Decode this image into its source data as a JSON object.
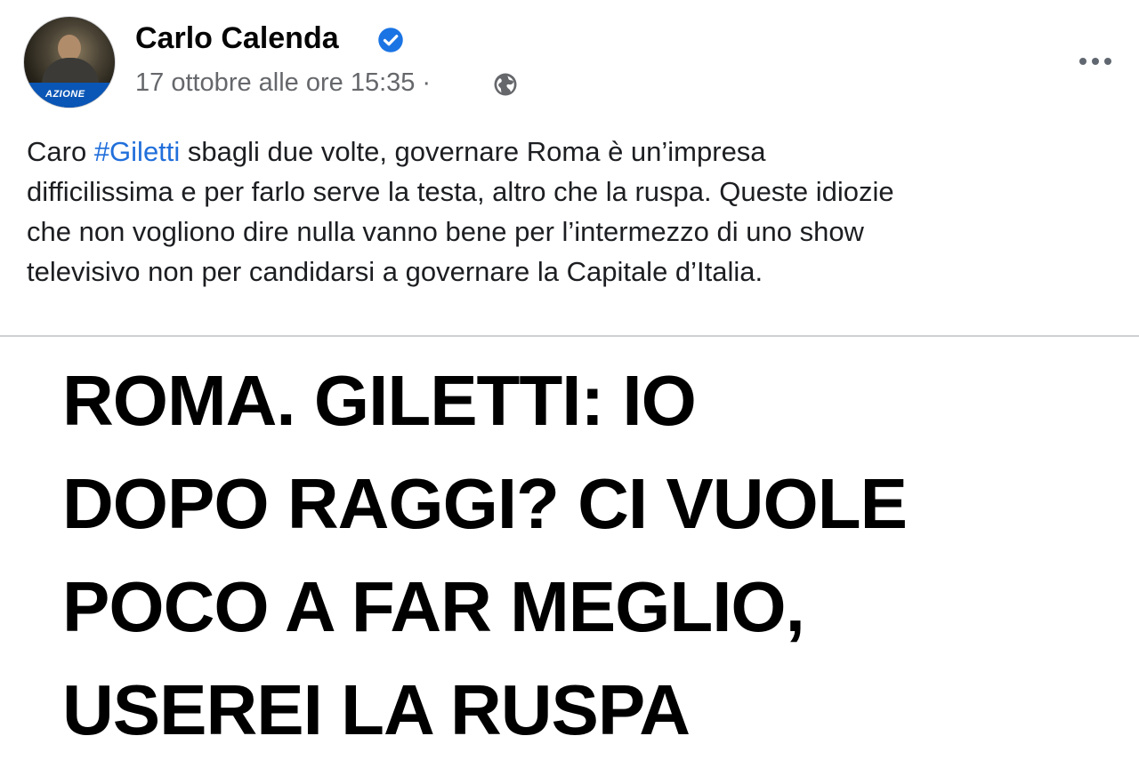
{
  "post": {
    "author": "Carlo Calenda",
    "avatar_badge": "AZIONE",
    "timestamp": "17 ottobre alle ore 15:35",
    "separator": "·",
    "text_lines": [
      {
        "before": "Caro ",
        "hashtag": "#Giletti",
        "after": " sbagli due volte, governare Roma è un’impresa"
      },
      "difficilissima e per farlo serve la testa, altro che la ruspa. Queste idiozie",
      "che non vogliono dire nulla vanno bene per l’intermezzo di uno show",
      "televisivo non per candidarsi a governare la Capitale d’Italia."
    ]
  },
  "image": {
    "headline_lines": [
      "ROMA. GILETTI: IO",
      "DOPO RAGGI? CI VUOLE",
      "POCO A FAR MEGLIO,",
      "USEREI LA RUSPA"
    ]
  },
  "icons": {
    "verified": "verified-badge-icon",
    "audience": "globe-icon",
    "more": "more-options-icon"
  },
  "colors": {
    "verified_blue": "#1b74e4",
    "hashtag_blue": "#216fdb",
    "meta_gray": "#65676b",
    "badge_blue": "#0a56b6"
  }
}
